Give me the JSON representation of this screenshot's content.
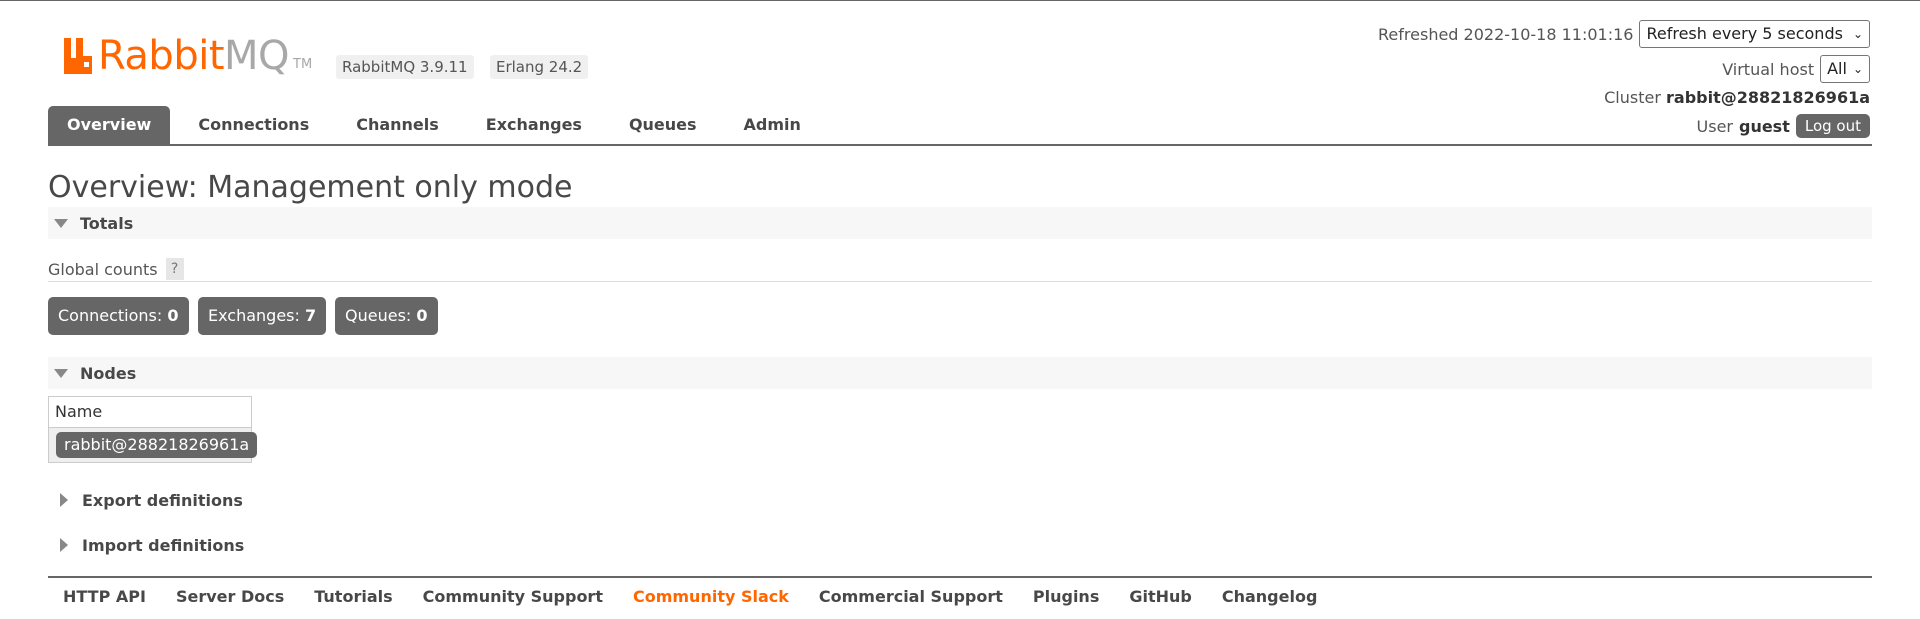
{
  "brand": {
    "logo_name": "RabbitMQ",
    "logo_name_rabbit": "Rabbit",
    "logo_name_mq": "MQ",
    "logo_tm": "TM",
    "accent_color": "#ff6600",
    "version": "RabbitMQ 3.9.11",
    "erlang": "Erlang 24.2"
  },
  "status": {
    "refreshed_label": "Refreshed 2022-10-18 11:01:16",
    "refresh_select": "Refresh every 5 seconds",
    "vhost_label": "Virtual host",
    "vhost_select": "All",
    "cluster_label": "Cluster",
    "cluster_name": "rabbit@28821826961a",
    "user_label": "User",
    "user_name": "guest",
    "logout_label": "Log out"
  },
  "nav": {
    "tabs": [
      {
        "label": "Overview",
        "active": true
      },
      {
        "label": "Connections",
        "active": false
      },
      {
        "label": "Channels",
        "active": false
      },
      {
        "label": "Exchanges",
        "active": false
      },
      {
        "label": "Queues",
        "active": false
      },
      {
        "label": "Admin",
        "active": false
      }
    ]
  },
  "main": {
    "title": "Overview: Management only mode",
    "totals": {
      "heading": "Totals",
      "global_counts_label": "Global counts",
      "help_label": "?",
      "connections_label": "Connections:",
      "connections_value": "0",
      "exchanges_label": "Exchanges:",
      "exchanges_value": "7",
      "queues_label": "Queues:",
      "queues_value": "0"
    },
    "nodes": {
      "heading": "Nodes",
      "column_name": "Name",
      "rows": [
        "rabbit@28821826961a"
      ]
    },
    "export_heading": "Export definitions",
    "import_heading": "Import definitions"
  },
  "footer": {
    "links": [
      "HTTP API",
      "Server Docs",
      "Tutorials",
      "Community Support",
      "Community Slack",
      "Commercial Support",
      "Plugins",
      "GitHub",
      "Changelog"
    ]
  }
}
